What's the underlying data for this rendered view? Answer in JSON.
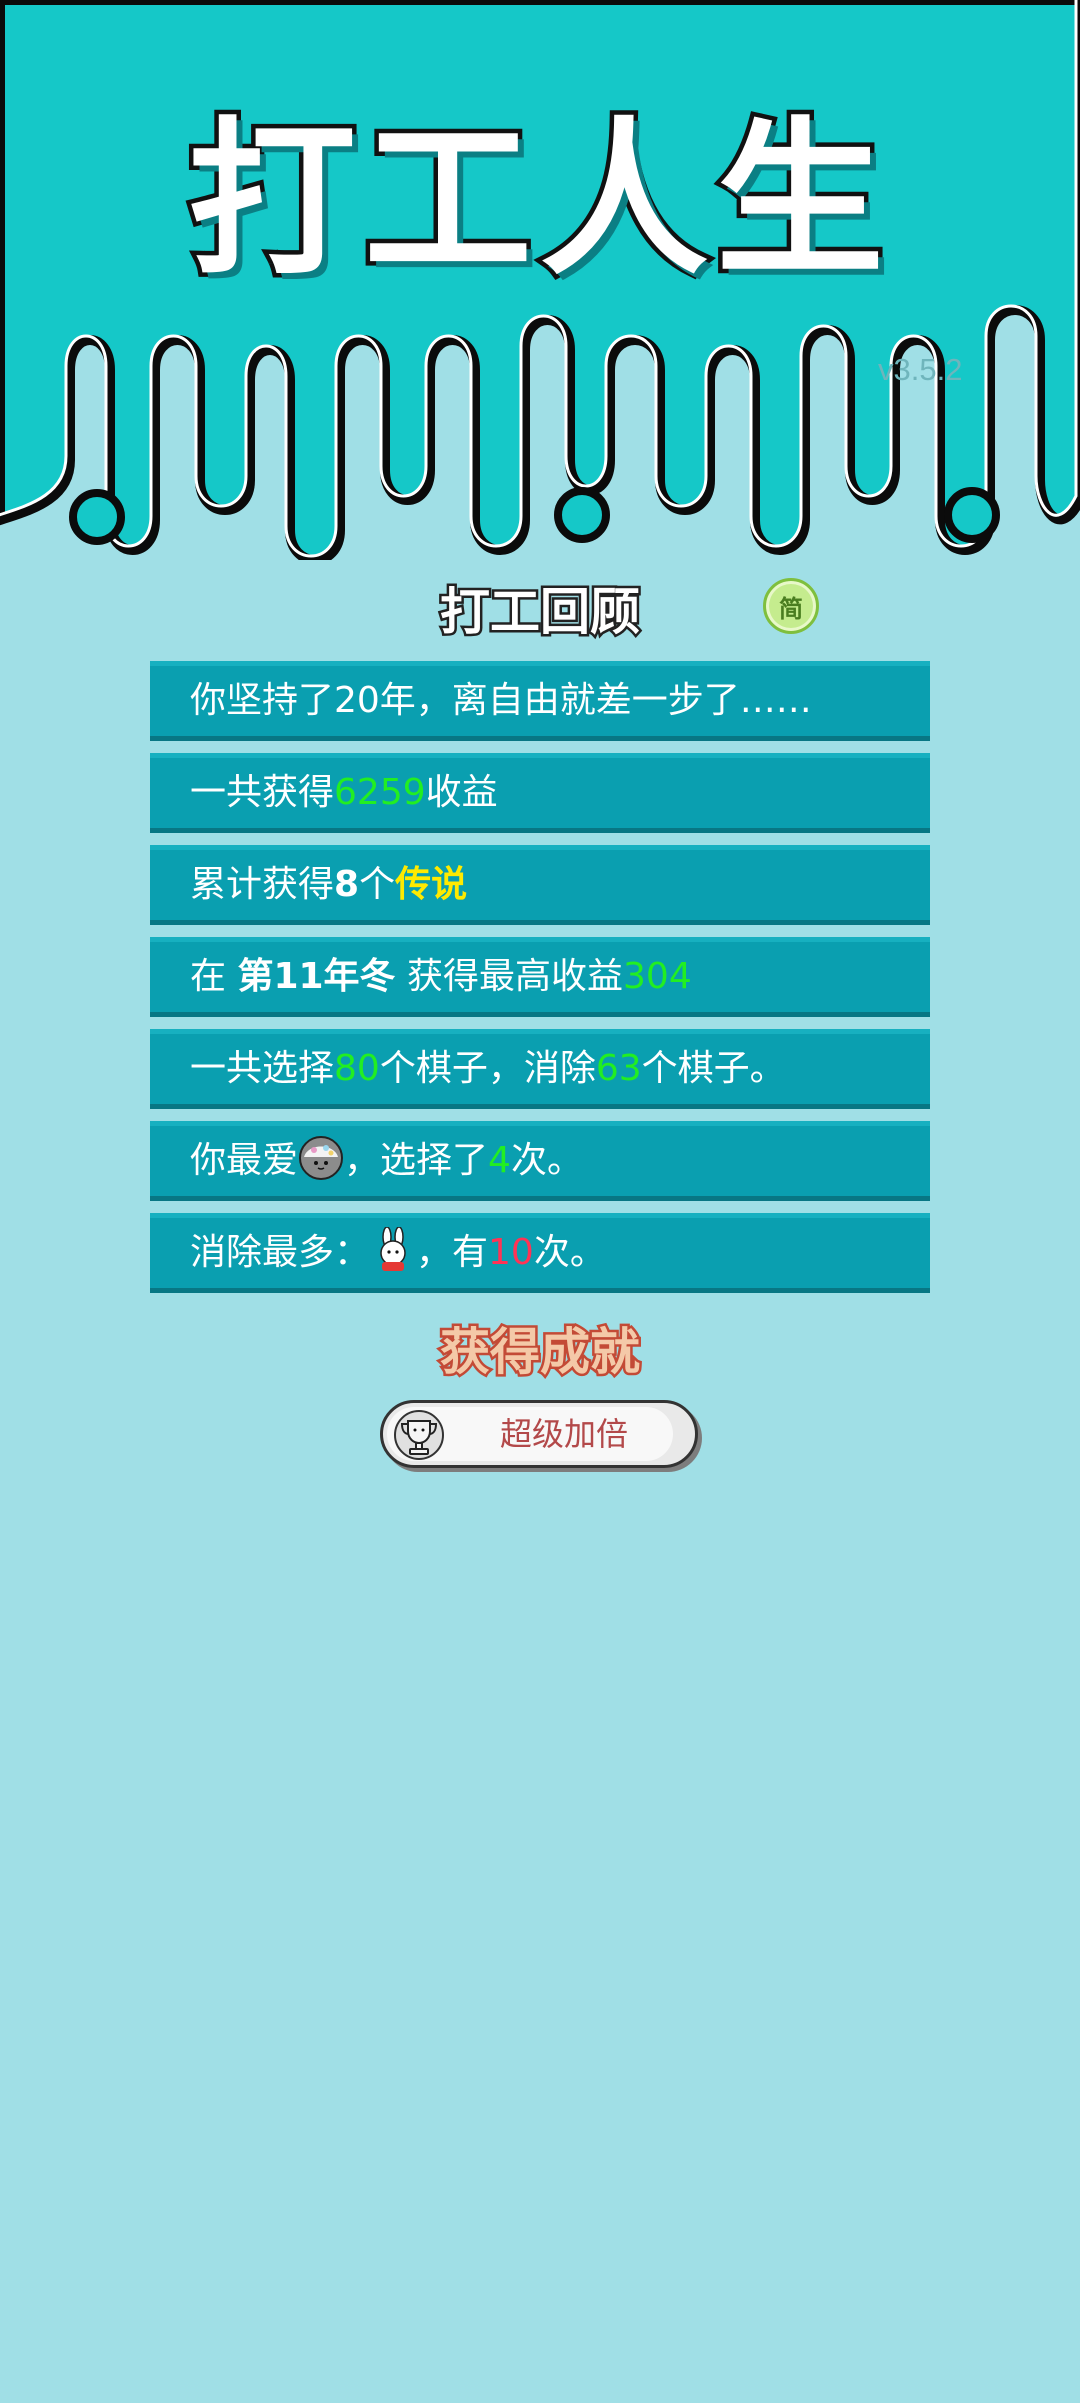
{
  "app": {
    "title": "打工人生",
    "version": "v3.5.2"
  },
  "review": {
    "title": "打工回顾",
    "toggle_label": "简",
    "rows": {
      "r1": {
        "text": "你坚持了20年，离自由就差一步了……"
      },
      "r2": {
        "prefix": "一共获得",
        "value": "6259",
        "suffix": "收益"
      },
      "r3": {
        "prefix": "累计获得",
        "count": "8",
        "mid": "个",
        "label": "传说"
      },
      "r4": {
        "prefix": "在 ",
        "time": "第11年冬",
        "mid": " 获得最高收益",
        "value": "304"
      },
      "r5": {
        "p1": "一共选择",
        "v1": "80",
        "p2": "个棋子，消除",
        "v2": "63",
        "p3": "个棋子。"
      },
      "r6": {
        "prefix": "你最爱",
        "mid": "，选择了",
        "count": "4",
        "suffix": "次。",
        "icon": "rice-ball-icon"
      },
      "r7": {
        "prefix": "消除最多：",
        "mid": "，有",
        "count": "10",
        "suffix": "次。",
        "icon": "rabbit-icon"
      }
    }
  },
  "achievements": {
    "title": "获得成就",
    "badge_label": "超级加倍",
    "badge_icon": "trophy-icon"
  },
  "colors": {
    "background": "#a0dfe6",
    "header": "#15c8c8",
    "row": "#0a9fb0",
    "highlight_green": "#22ee22",
    "highlight_yellow": "#ffea00",
    "highlight_red": "#ff3355"
  }
}
